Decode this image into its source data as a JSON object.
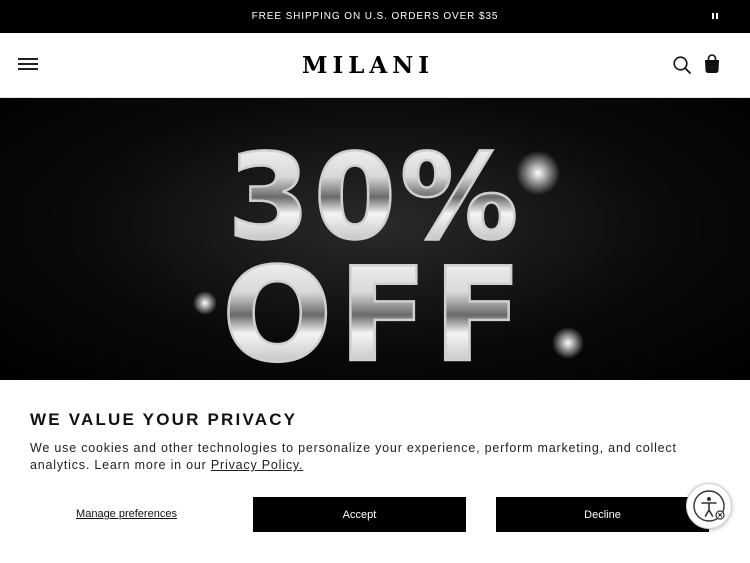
{
  "announcement": {
    "text": "FREE SHIPPING ON U.S. ORDERS OVER $35"
  },
  "header": {
    "logo_text": "MILANI"
  },
  "hero": {
    "line1": "30%",
    "line2": "OFF"
  },
  "privacy": {
    "title": "WE VALUE YOUR PRIVACY",
    "body": "We use cookies and other technologies to personalize your experience, perform marketing, and collect analytics. Learn more in our ",
    "link": "Privacy Policy.",
    "manage_label": "Manage preferences",
    "accept_label": "Accept",
    "decline_label": "Decline"
  }
}
